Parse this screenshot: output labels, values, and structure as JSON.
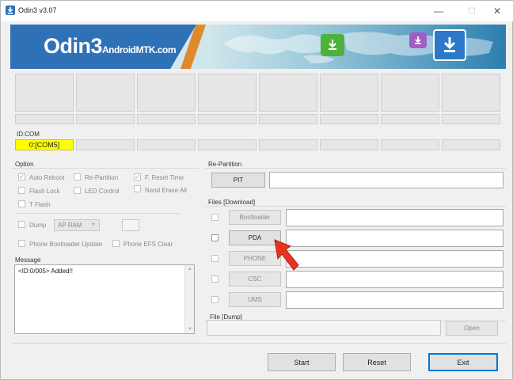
{
  "window": {
    "title": "Odin3 v3.07",
    "minimize": "—",
    "maximize": "☐",
    "close": "✕"
  },
  "banner": {
    "logo_main": "Odin3",
    "logo_sub": "AndroidMTK.com"
  },
  "id_com": {
    "label": "ID:COM",
    "port": "0:[COM5]"
  },
  "options": {
    "title": "Option",
    "auto_reboot": "Auto Reboot",
    "re_partition": "Re-Partition",
    "f_reset_time": "F. Reset Time",
    "flash_lock": "Flash Lock",
    "led_control": "LED Control",
    "nand_erase_all": "Nand Erase All",
    "t_flash": "T Flash",
    "dump": "Dump",
    "dump_select": "AP RAM",
    "phone_bootloader_update": "Phone Bootloader Update",
    "phone_efs_clear": "Phone EFS Clear"
  },
  "message": {
    "title": "Message",
    "text": "<ID:0/005> Added!!"
  },
  "repartition": {
    "title": "Re-Partition",
    "pit_button": "PIT"
  },
  "files": {
    "title": "Files [Download]",
    "bootloader": "Bootloader",
    "pda": "PDA",
    "phone": "PHONE",
    "csc": "CSC",
    "ums": "UMS"
  },
  "file_dump": {
    "title": "File [Dump]",
    "open_button": "Open"
  },
  "actions": {
    "start": "Start",
    "reset": "Reset",
    "exit": "Exit"
  },
  "colors": {
    "com_highlight": "#ffff00",
    "arrow": "#e8341f",
    "logo_blue": "#2f71b6"
  }
}
